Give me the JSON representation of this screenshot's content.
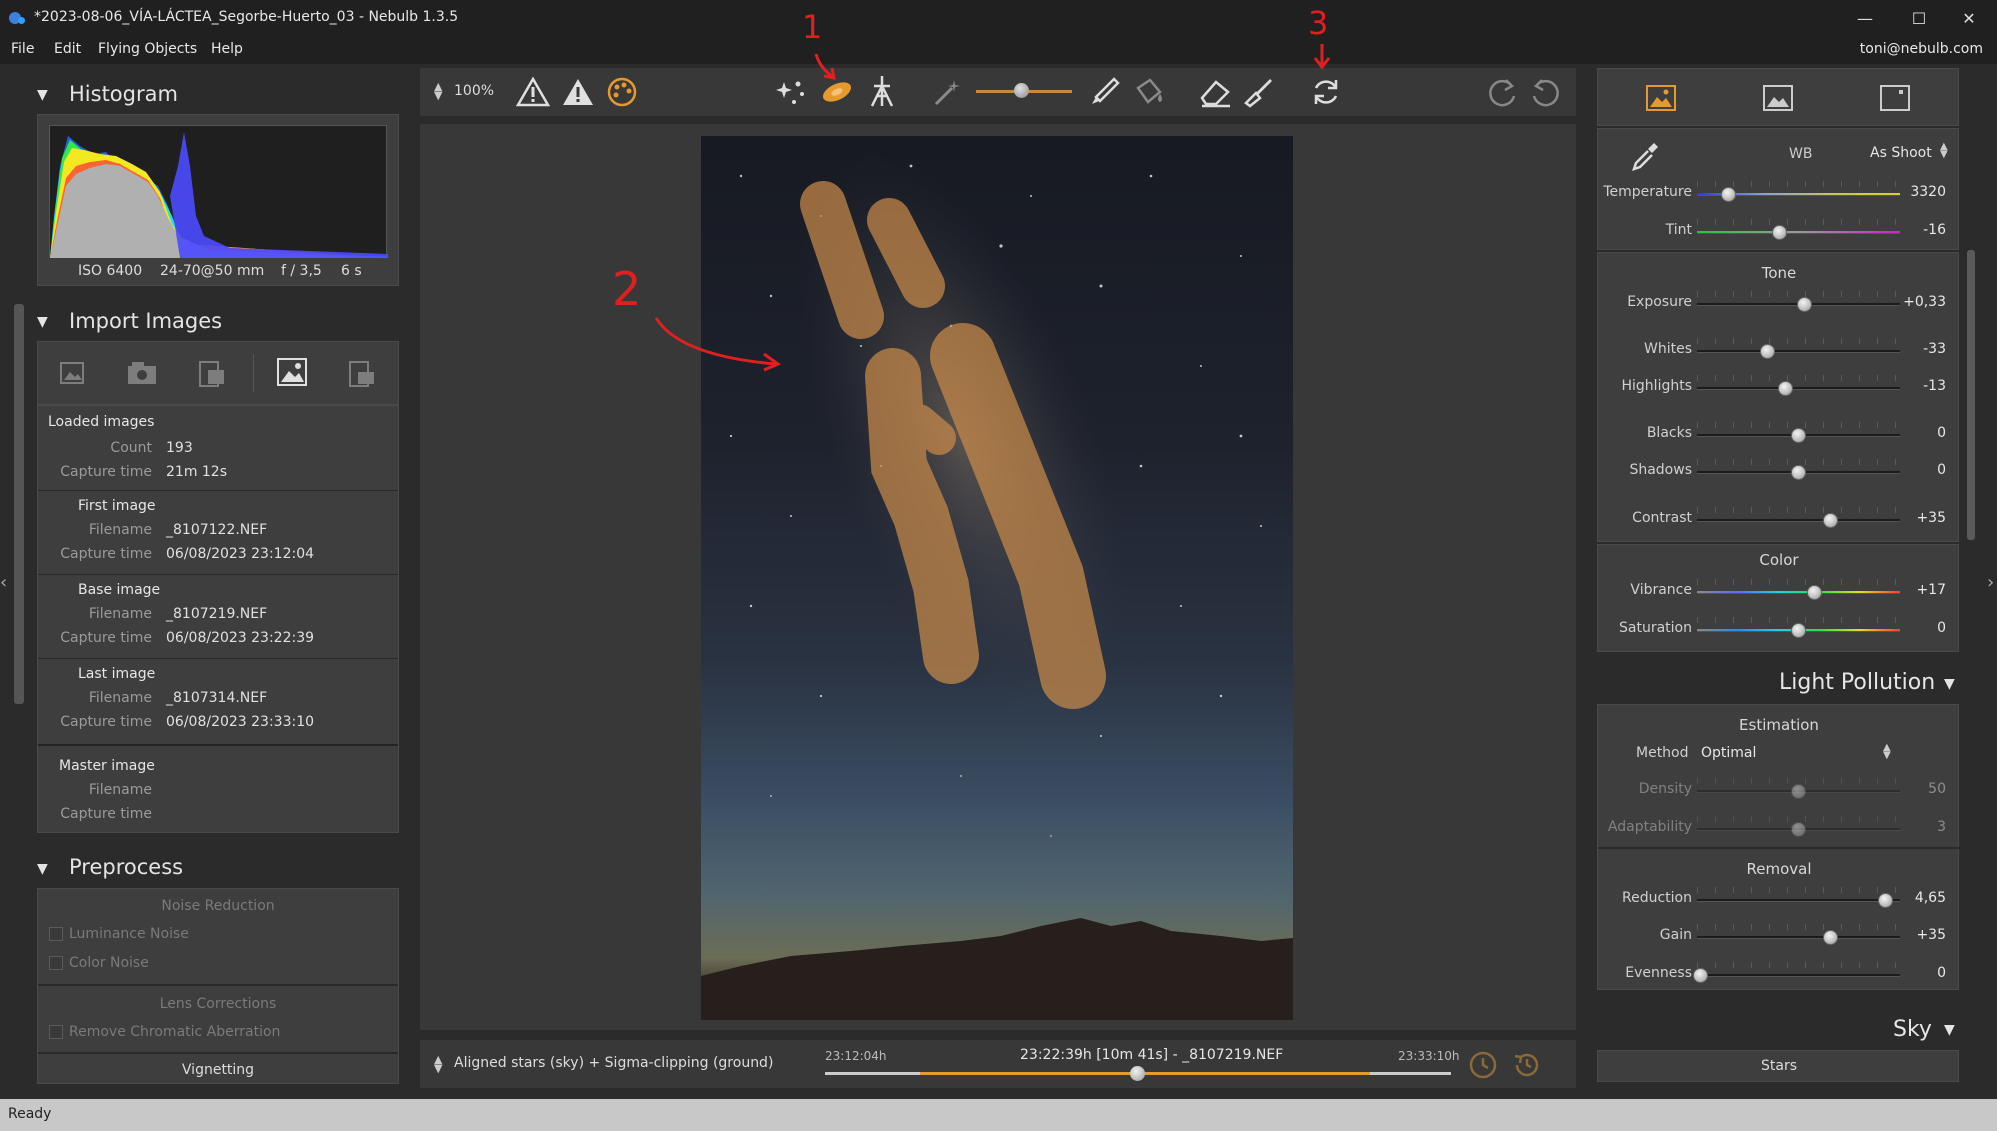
{
  "window": {
    "title": "*2023-08-06_VÍA-LÁCTEA_Segorbe-Huerto_03 - Nebulb 1.3.5",
    "user": "toni@nebulb.com",
    "status": "Ready"
  },
  "menu": [
    "File",
    "Edit",
    "Flying Objects",
    "Help"
  ],
  "toolbar": {
    "zoom": "100%"
  },
  "annotations": [
    "1",
    "2",
    "3"
  ],
  "histogram": {
    "title": "Histogram",
    "iso": "ISO 6400",
    "lens": "24-70@50 mm",
    "aperture": "f / 3,5",
    "exposure": "6 s"
  },
  "import": {
    "title": "Import Images",
    "loaded_header": "Loaded images",
    "count_label": "Count",
    "count": "193",
    "capture_label": "Capture time",
    "capture": "21m 12s",
    "filename_label": "Filename",
    "first": {
      "header": "First image",
      "filename": "_8107122.NEF",
      "capture": "06/08/2023 23:12:04"
    },
    "base": {
      "header": "Base image",
      "filename": "_8107219.NEF",
      "capture": "06/08/2023 23:22:39"
    },
    "last": {
      "header": "Last image",
      "filename": "_8107314.NEF",
      "capture": "06/08/2023 23:33:10"
    },
    "master": {
      "header": "Master image"
    }
  },
  "preprocess": {
    "title": "Preprocess",
    "noise_header": "Noise Reduction",
    "luminance": "Luminance Noise",
    "color_noise": "Color Noise",
    "lens_header": "Lens Corrections",
    "chromatic": "Remove Chromatic Aberration",
    "vignetting": "Vignetting"
  },
  "bottom_bar": {
    "mode": "Aligned stars (sky) + Sigma-clipping (ground)",
    "time_start": "23:12:04h",
    "time_current": "23:22:39h [10m 41s] - _8107219.NEF",
    "time_end": "23:33:10h",
    "timeline_position": 0.5
  },
  "adjust": {
    "wb_label": "WB",
    "wb_value": "As Shoot",
    "tone_header": "Tone",
    "color_header": "Color",
    "sliders": {
      "temperature": {
        "label": "Temperature",
        "value": "3320",
        "pos": 0.16
      },
      "tint": {
        "label": "Tint",
        "value": "-16",
        "pos": 0.41
      },
      "exposure": {
        "label": "Exposure",
        "value": "+0,33",
        "pos": 0.53
      },
      "whites": {
        "label": "Whites",
        "value": "-33",
        "pos": 0.35
      },
      "highlights": {
        "label": "Highlights",
        "value": "-13",
        "pos": 0.44
      },
      "blacks": {
        "label": "Blacks",
        "value": "0",
        "pos": 0.5
      },
      "shadows": {
        "label": "Shadows",
        "value": "0",
        "pos": 0.5
      },
      "contrast": {
        "label": "Contrast",
        "value": "+35",
        "pos": 0.66
      },
      "vibrance": {
        "label": "Vibrance",
        "value": "+17",
        "pos": 0.58
      },
      "saturation": {
        "label": "Saturation",
        "value": "0",
        "pos": 0.5
      }
    }
  },
  "light_pollution": {
    "title": "Light Pollution",
    "estimation_header": "Estimation",
    "method_label": "Method",
    "method_value": "Optimal",
    "removal_header": "Removal",
    "sliders": {
      "density": {
        "label": "Density",
        "value": "50",
        "pos": 0.5
      },
      "adaptability": {
        "label": "Adaptability",
        "value": "3",
        "pos": 0.5
      },
      "reduction": {
        "label": "Reduction",
        "value": "4,65",
        "pos": 0.93
      },
      "gain": {
        "label": "Gain",
        "value": "+35",
        "pos": 0.66
      },
      "evenness": {
        "label": "Evenness",
        "value": "0",
        "pos": 0.02
      }
    }
  },
  "sky": {
    "title": "Sky",
    "stars": "Stars"
  },
  "colors": {
    "accent": "#e59a2e",
    "annotation": "#e02020",
    "mask": "#c88a4a"
  }
}
